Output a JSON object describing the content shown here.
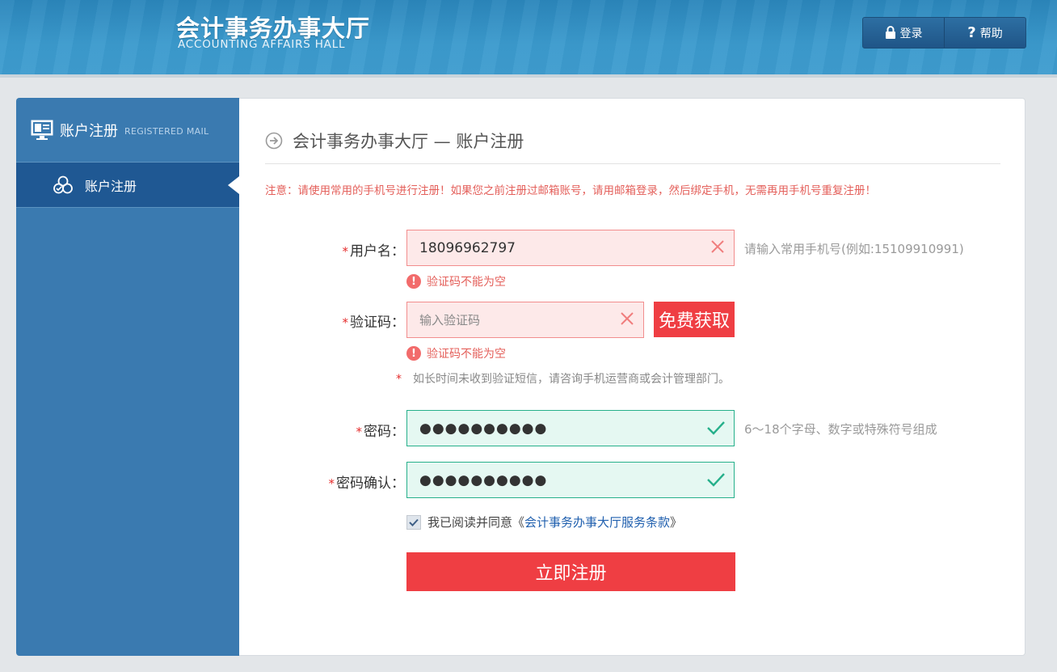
{
  "header": {
    "logo_cn": "会计事务办事大厅",
    "logo_en": "ACCOUNTING AFFAIRS HALL",
    "login_label": "登录",
    "help_label": "帮助"
  },
  "sidebar": {
    "title": "账户注册",
    "title_en": "REGISTERED MAIL",
    "items": [
      {
        "label": "账户注册",
        "active": true
      }
    ]
  },
  "main": {
    "title": "会计事务办事大厅 — 账户注册",
    "notice": "注意：请使用常用的手机号进行注册！如果您之前注册过邮箱账号，请用邮箱登录，然后绑定手机，无需再用手机号重复注册！",
    "form": {
      "username": {
        "label": "用户名：",
        "value": "18096962797",
        "hint": "请输入常用手机号(例如:15109910991)",
        "error": "验证码不能为空"
      },
      "captcha": {
        "label": "验证码：",
        "value": "",
        "placeholder": "输入验证码",
        "button": "免费获取",
        "error": "验证码不能为空",
        "sms_note": "如长时间未收到验证短信，请咨询手机运营商或会计管理部门。"
      },
      "password": {
        "label": "密码：",
        "value": "●●●●●●●●●●",
        "hint": "6～18个字母、数字或特殊符号组成"
      },
      "password_confirm": {
        "label": "密码确认：",
        "value": "●●●●●●●●●●"
      },
      "agree": {
        "text": "我已阅读并同意《",
        "link": "会计事务办事大厅服务条款",
        "suffix": "》",
        "checked": true
      },
      "submit": "立即注册",
      "required_mark": "*"
    }
  },
  "colors": {
    "header_blue": "#3b9acd",
    "sidebar_blue": "#3a7ab0",
    "sidebar_active": "#1f5893",
    "accent_red": "#ef3e43",
    "ok_green": "#26b08b"
  }
}
